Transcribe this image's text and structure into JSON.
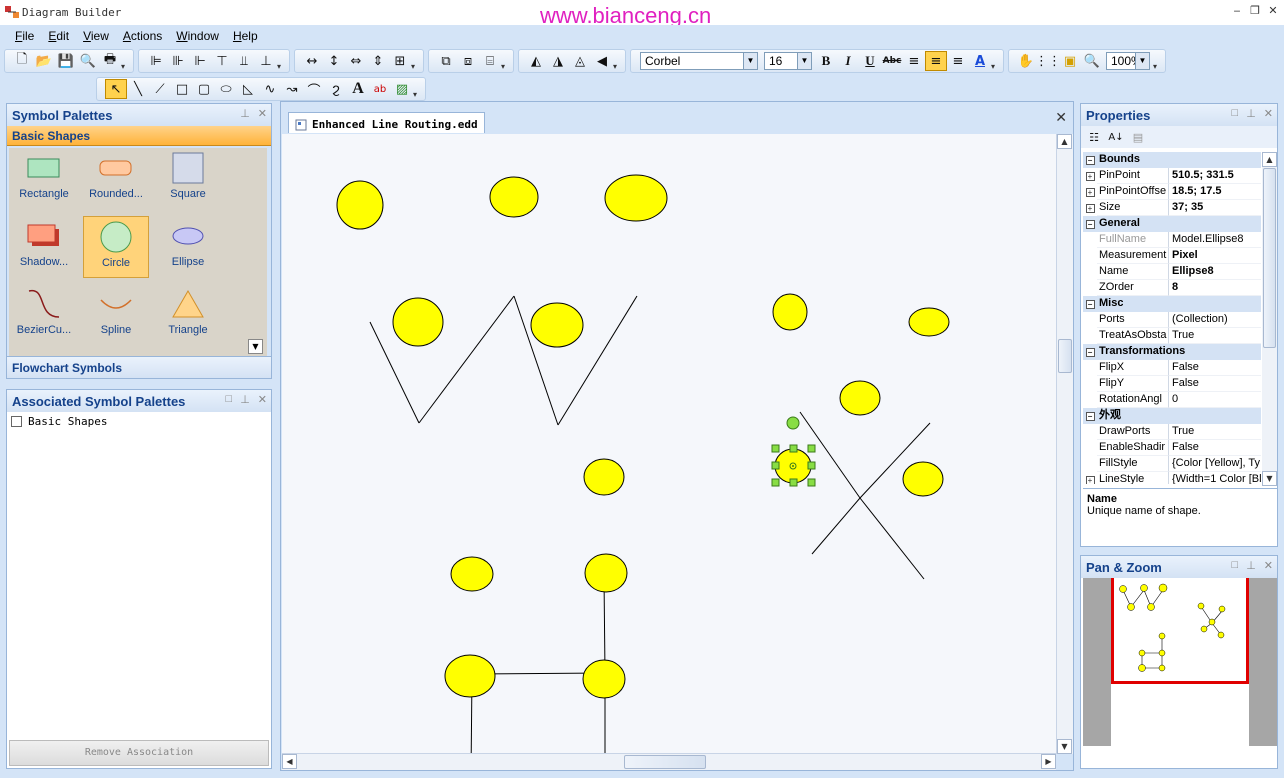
{
  "window": {
    "title": "Diagram Builder",
    "watermark": "www.bianceng.cn"
  },
  "menu": [
    "File",
    "Edit",
    "View",
    "Actions",
    "Window",
    "Help"
  ],
  "toolbar": {
    "font_name": "Corbel",
    "font_size": "16",
    "zoom": "100%"
  },
  "symbol_palettes": {
    "title": "Symbol Palettes",
    "active_tab": "Basic Shapes",
    "items": [
      {
        "label": "Rectangle",
        "icon": "rectangle-shape-icon"
      },
      {
        "label": "Rounded...",
        "icon": "rounded-rectangle-shape-icon"
      },
      {
        "label": "Square",
        "icon": "square-shape-icon"
      },
      {
        "label": "Shadow...",
        "icon": "shadow-rectangle-shape-icon"
      },
      {
        "label": "Circle",
        "icon": "circle-shape-icon",
        "selected": true
      },
      {
        "label": "Ellipse",
        "icon": "ellipse-shape-icon"
      },
      {
        "label": "BezierCu...",
        "icon": "bezier-curve-shape-icon"
      },
      {
        "label": "Spline",
        "icon": "spline-shape-icon"
      },
      {
        "label": "Triangle",
        "icon": "triangle-shape-icon"
      }
    ],
    "other_tab": "Flowchart Symbols"
  },
  "associated_palettes": {
    "title": "Associated Symbol Palettes",
    "items": [
      "Basic Shapes"
    ],
    "remove_button": "Remove Association"
  },
  "document": {
    "tab_title": "Enhanced Line Routing.edd"
  },
  "properties": {
    "title": "Properties",
    "rows": [
      {
        "type": "cat",
        "k": "Bounds"
      },
      {
        "type": "row",
        "exp": true,
        "k": "PinPoint",
        "v": "510.5; 331.5",
        "bold": true
      },
      {
        "type": "row",
        "exp": true,
        "k": "PinPointOffse",
        "v": "18.5; 17.5",
        "bold": true
      },
      {
        "type": "row",
        "exp": true,
        "k": "Size",
        "v": "37; 35",
        "bold": true
      },
      {
        "type": "cat",
        "k": "General"
      },
      {
        "type": "row",
        "k": "FullName",
        "v": "Model.Ellipse8",
        "dim": true
      },
      {
        "type": "row",
        "k": "Measurement",
        "v": "Pixel",
        "bold": true
      },
      {
        "type": "row",
        "k": "Name",
        "v": "Ellipse8",
        "bold": true
      },
      {
        "type": "row",
        "k": "ZOrder",
        "v": "8",
        "bold": true
      },
      {
        "type": "cat",
        "k": "Misc"
      },
      {
        "type": "row",
        "k": "Ports",
        "v": "(Collection)"
      },
      {
        "type": "row",
        "k": "TreatAsObsta",
        "v": "True"
      },
      {
        "type": "cat",
        "k": "Transformations"
      },
      {
        "type": "row",
        "k": "FlipX",
        "v": "False"
      },
      {
        "type": "row",
        "k": "FlipY",
        "v": "False"
      },
      {
        "type": "row",
        "k": "RotationAngl",
        "v": "0"
      },
      {
        "type": "cat",
        "k": "外观"
      },
      {
        "type": "row",
        "k": "DrawPorts",
        "v": "True"
      },
      {
        "type": "row",
        "k": "EnableShadir",
        "v": "False"
      },
      {
        "type": "row",
        "k": "FillStyle",
        "v": "{Color [Yellow], Ty"
      },
      {
        "type": "row",
        "exp": true,
        "k": "LineStyle",
        "v": "{Width=1 Color [Bl"
      }
    ],
    "desc_title": "Name",
    "desc_text": "Unique name of shape."
  },
  "pan_zoom": {
    "title": "Pan & Zoom"
  },
  "colors": {
    "node_fill": "#ffff00",
    "accent_tab": "#ffb33a",
    "panel_title": "#15428b",
    "pan_frame": "#e00000"
  }
}
